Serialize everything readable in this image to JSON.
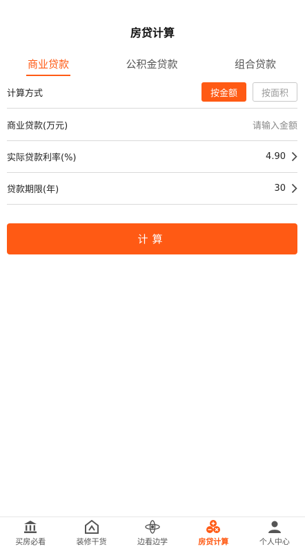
{
  "header": {
    "title": "房贷计算"
  },
  "tabs": [
    {
      "label": "商业贷款",
      "active": true
    },
    {
      "label": "公积金贷款",
      "active": false
    },
    {
      "label": "组合贷款",
      "active": false
    }
  ],
  "form": {
    "method": {
      "label": "计算方式",
      "options": [
        "按金额",
        "按面积"
      ],
      "selected": "按金额"
    },
    "amount": {
      "label": "商业贷款(万元)",
      "placeholder": "请输入金额",
      "value": ""
    },
    "rate": {
      "label": "实际贷款利率(%)",
      "value": "4.90"
    },
    "term": {
      "label": "贷款期限(年)",
      "value": "30"
    }
  },
  "calculate_button": {
    "label": "计算"
  },
  "bottom_nav": {
    "items": [
      {
        "label": "买房必看",
        "icon": "bank-icon",
        "active": false
      },
      {
        "label": "装修干货",
        "icon": "renovation-icon",
        "active": false
      },
      {
        "label": "边看边学",
        "icon": "learn-icon",
        "active": false
      },
      {
        "label": "房贷计算",
        "icon": "calculator-icon",
        "active": true
      },
      {
        "label": "个人中心",
        "icon": "person-icon",
        "active": false
      }
    ]
  },
  "colors": {
    "accent": "#ff5a14",
    "divider": "#d9d9d9",
    "muted": "#888888"
  }
}
